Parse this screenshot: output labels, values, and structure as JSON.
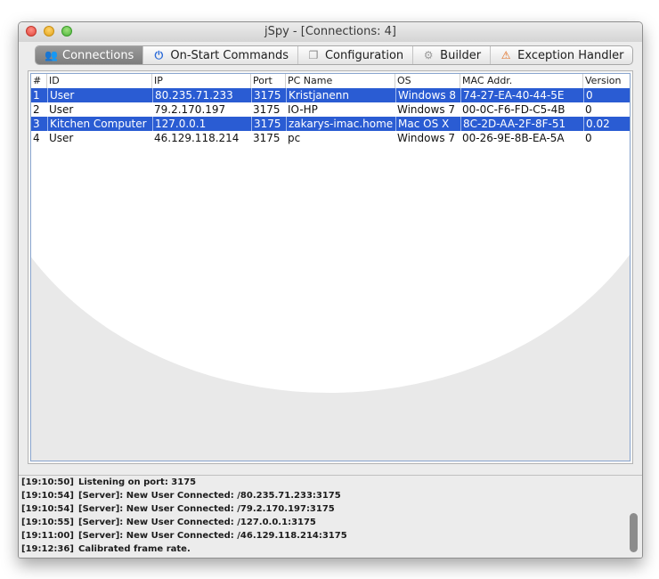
{
  "window": {
    "title": "jSpy - [Connections: 4]"
  },
  "tabs": [
    {
      "label": "Connections",
      "icon": "users-icon",
      "active": true
    },
    {
      "label": "On-Start Commands",
      "icon": "power-icon",
      "active": false
    },
    {
      "label": "Configuration",
      "icon": "config-icon",
      "active": false
    },
    {
      "label": "Builder",
      "icon": "gear-icon",
      "active": false
    },
    {
      "label": "Exception Handler",
      "icon": "exception-icon",
      "active": false
    }
  ],
  "table": {
    "columns": [
      "#",
      "ID",
      "IP",
      "Port",
      "PC Name",
      "OS",
      "MAC Addr.",
      "Version"
    ],
    "rows": [
      {
        "selected": true,
        "cells": [
          "1",
          "User",
          "80.235.71.233",
          "3175",
          "Kristjanenn",
          "Windows 8",
          "74-27-EA-40-44-5E",
          "0"
        ]
      },
      {
        "selected": false,
        "cells": [
          "2",
          "User",
          "79.2.170.197",
          "3175",
          "IO-HP",
          "Windows 7",
          "00-0C-F6-FD-C5-4B",
          "0"
        ]
      },
      {
        "selected": true,
        "cells": [
          "3",
          "Kitchen Computer",
          "127.0.0.1",
          "3175",
          "zakarys-imac.home",
          "Mac OS X",
          "8C-2D-AA-2F-8F-51",
          "0.02"
        ]
      },
      {
        "selected": false,
        "cells": [
          "4",
          "User",
          "46.129.118.214",
          "3175",
          "pc",
          "Windows 7",
          "00-26-9E-8B-EA-5A",
          "0"
        ]
      }
    ]
  },
  "log": [
    {
      "time": "[19:10:50]",
      "message": "Listening on port: 3175"
    },
    {
      "time": "[19:10:54]",
      "message": "[Server]: New User Connected: /80.235.71.233:3175"
    },
    {
      "time": "[19:10:54]",
      "message": "[Server]: New User Connected: /79.2.170.197:3175"
    },
    {
      "time": "[19:10:55]",
      "message": "[Server]: New User Connected: /127.0.0.1:3175"
    },
    {
      "time": "[19:11:00]",
      "message": "[Server]: New User Connected: /46.129.118.214:3175"
    },
    {
      "time": "[19:12:36]",
      "message": "Calibrated frame rate."
    }
  ],
  "colors": {
    "selection": "#2a5cd3",
    "active_tab": "#8a8a8a"
  }
}
